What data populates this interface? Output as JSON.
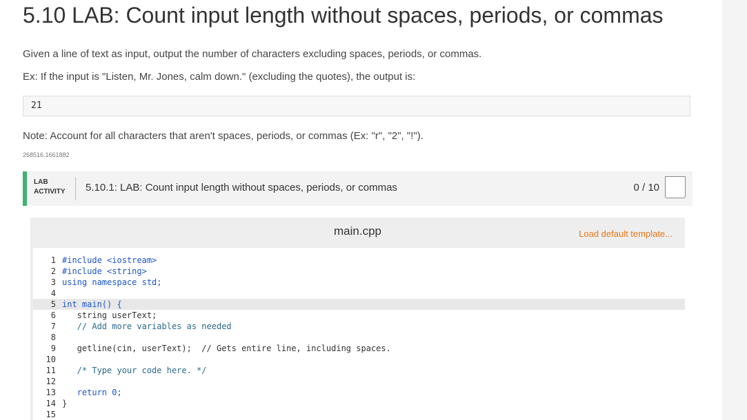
{
  "page": {
    "title": "5.10 LAB: Count input length without spaces, periods, or commas",
    "description": "Given a line of text as input, output the number of characters excluding spaces, periods, or commas.",
    "example": "Ex: If the input is \"Listen, Mr. Jones, calm down.\" (excluding the quotes), the output is:",
    "output_example": "21",
    "note": "Note: Account for all characters that aren't spaces, periods, or commas (Ex: \"r\", \"2\", \"!\").",
    "activity_id": "268516.1661882"
  },
  "lab": {
    "badge_line1": "LAB",
    "badge_line2": "ACTIVITY",
    "title": "5.10.1: LAB: Count input length without spaces, periods, or commas",
    "score": "0 / 10",
    "accent_color": "#3cb371"
  },
  "editor": {
    "file_name": "main.cpp",
    "load_template": "Load default template...",
    "link_color": "#e8761b",
    "active_line": 5,
    "lines": [
      {
        "n": "1",
        "text": "#include <iostream>"
      },
      {
        "n": "2",
        "text": "#include <string>"
      },
      {
        "n": "3",
        "text": "using namespace std;"
      },
      {
        "n": "4",
        "text": ""
      },
      {
        "n": "5",
        "text": "int main() {"
      },
      {
        "n": "6",
        "text": "   string userText;"
      },
      {
        "n": "7",
        "text": "   // Add more variables as needed"
      },
      {
        "n": "8",
        "text": ""
      },
      {
        "n": "9",
        "text": "   getline(cin, userText);  // Gets entire line, including spaces."
      },
      {
        "n": "10",
        "text": ""
      },
      {
        "n": "11",
        "text": "   /* Type your code here. */"
      },
      {
        "n": "12",
        "text": ""
      },
      {
        "n": "13",
        "text": "   return 0;"
      },
      {
        "n": "14",
        "text": "}"
      },
      {
        "n": "15",
        "text": ""
      }
    ]
  }
}
